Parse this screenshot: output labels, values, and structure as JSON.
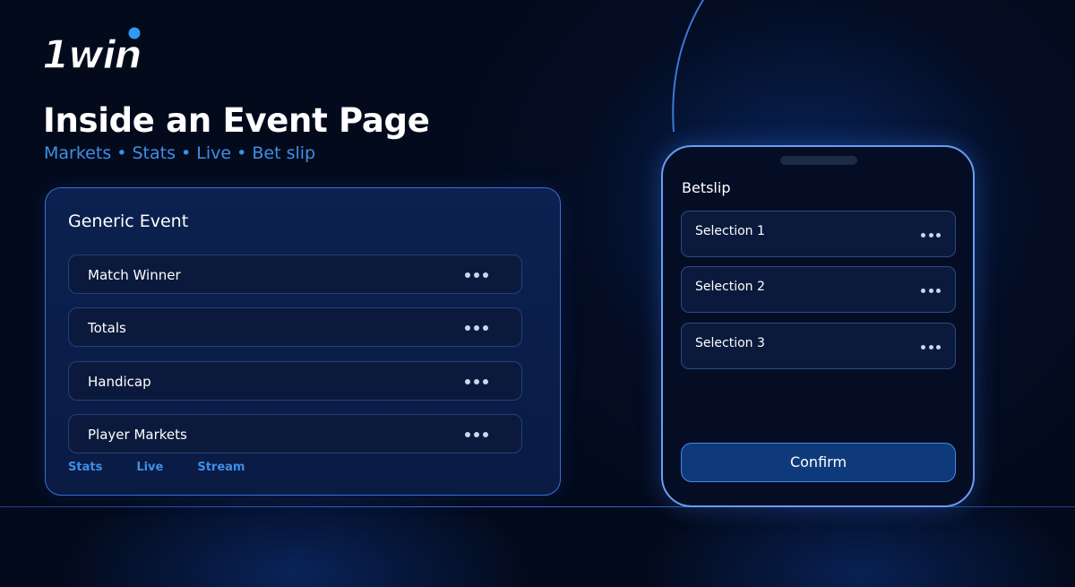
{
  "brand": {
    "logo_text": "1win",
    "accent": "#3f8fe6"
  },
  "header": {
    "title": "Inside an Event Page",
    "subtitle": "Markets • Stats • Live • Bet slip"
  },
  "event": {
    "title": "Generic Event",
    "markets": [
      {
        "label": "Match Winner",
        "icon": "more-dots-icon"
      },
      {
        "label": "Totals",
        "icon": "more-dots-icon"
      },
      {
        "label": "Handicap",
        "icon": "more-dots-icon"
      },
      {
        "label": "Player Markets",
        "icon": "more-dots-icon"
      }
    ],
    "links": [
      "Stats",
      "Live",
      "Stream"
    ]
  },
  "betslip": {
    "title": "Betslip",
    "selections": [
      {
        "label": "Selection 1",
        "icon": "more-dots-icon"
      },
      {
        "label": "Selection 2",
        "icon": "more-dots-icon"
      },
      {
        "label": "Selection 3",
        "icon": "more-dots-icon"
      }
    ],
    "confirm_label": "Confirm"
  }
}
